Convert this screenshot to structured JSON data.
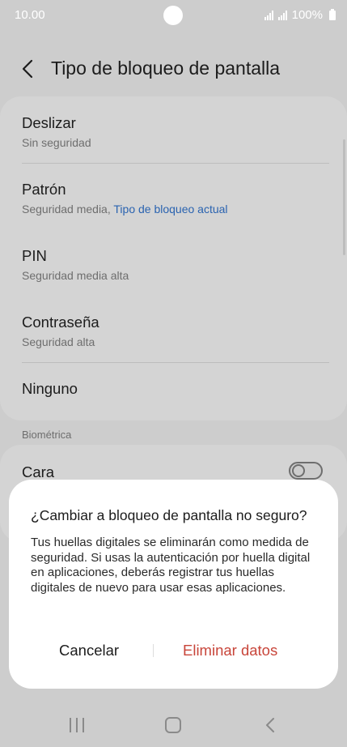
{
  "status_bar": {
    "time": "10.00",
    "battery": "100%"
  },
  "header": {
    "title": "Tipo de bloqueo de pantalla"
  },
  "lock_options": [
    {
      "title": "Deslizar",
      "subtitle": "Sin seguridad"
    },
    {
      "title": "Patrón",
      "subtitle": "Seguridad media,",
      "subtitle_accent": "Tipo de bloqueo actual"
    },
    {
      "title": "PIN",
      "subtitle": "Seguridad media alta"
    },
    {
      "title": "Contraseña",
      "subtitle": "Seguridad alta"
    },
    {
      "title": "Ninguno"
    }
  ],
  "biometrics": {
    "section_label": "Biométrica",
    "face_label": "Cara",
    "face_enabled": false
  },
  "dialog": {
    "title": "¿Cambiar a bloqueo de pantalla no seguro?",
    "body": "Tus huellas digitales se eliminarán como medida de seguridad. Si usas la autenticación por huella digital en aplicaciones, deberás registrar tus huellas digitales de nuevo para usar esas aplicaciones.",
    "cancel_label": "Cancelar",
    "confirm_label": "Eliminar datos"
  },
  "nav_bar": {
    "icons": [
      "recents-icon",
      "home-icon",
      "back-icon"
    ]
  },
  "colors": {
    "accent_link": "#2a63b0",
    "destructive": "#c8453a",
    "scrim_background": "#cdcdcd"
  }
}
